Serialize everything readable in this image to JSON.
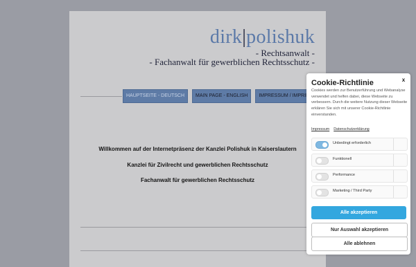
{
  "logo": {
    "part1": "dirk",
    "divider": "|",
    "part2": "polishuk"
  },
  "subtitles": [
    "- Rechtsanwalt -",
    "- Fachanwalt für gewerblichen Rechtsschutz -"
  ],
  "nav": [
    "HAUPTSEITE - DEUTSCH",
    "MAIN PAGE - ENGLISH",
    "IMPRESSUM / IMPRINT"
  ],
  "main": {
    "welcome": "Willkommen auf der Internetpräsenz der Kanzlei Polishuk in Kaiserslautern",
    "line2": "Kanzlei für Zivilrecht und gewerblichen Rechtsschutz",
    "line3": "Fachanwalt für gewerblichen Rechtsschutz"
  },
  "cookie": {
    "title": "Cookie-Richtlinie",
    "close": "x",
    "description": "Cookies werden zur Benutzerführung und Webanalyse verwendet und helfen dabei, diese Webseite zu verbessern. Durch die weitere Nutzung dieser Webseite erklären Sie sich mit unserer Cookie-Richtlinie einverstanden.",
    "links": [
      "Impressum",
      "Datenschutzerklärung"
    ],
    "options": [
      {
        "label": "Unbedingt erforderlich",
        "enabled": true
      },
      {
        "label": "Funktionell",
        "enabled": false
      },
      {
        "label": "Performance",
        "enabled": false
      },
      {
        "label": "Marketing / Third Party",
        "enabled": false
      }
    ],
    "buttons": {
      "accept_all": "Alle akzeptieren",
      "accept_selection": "Nur Auswahl akzeptieren",
      "reject_all": "Alle ablehnen"
    }
  },
  "colors": {
    "accent": "#33a7df",
    "nav": "#5e7ba6",
    "logo_accent": "#5b79a8"
  }
}
